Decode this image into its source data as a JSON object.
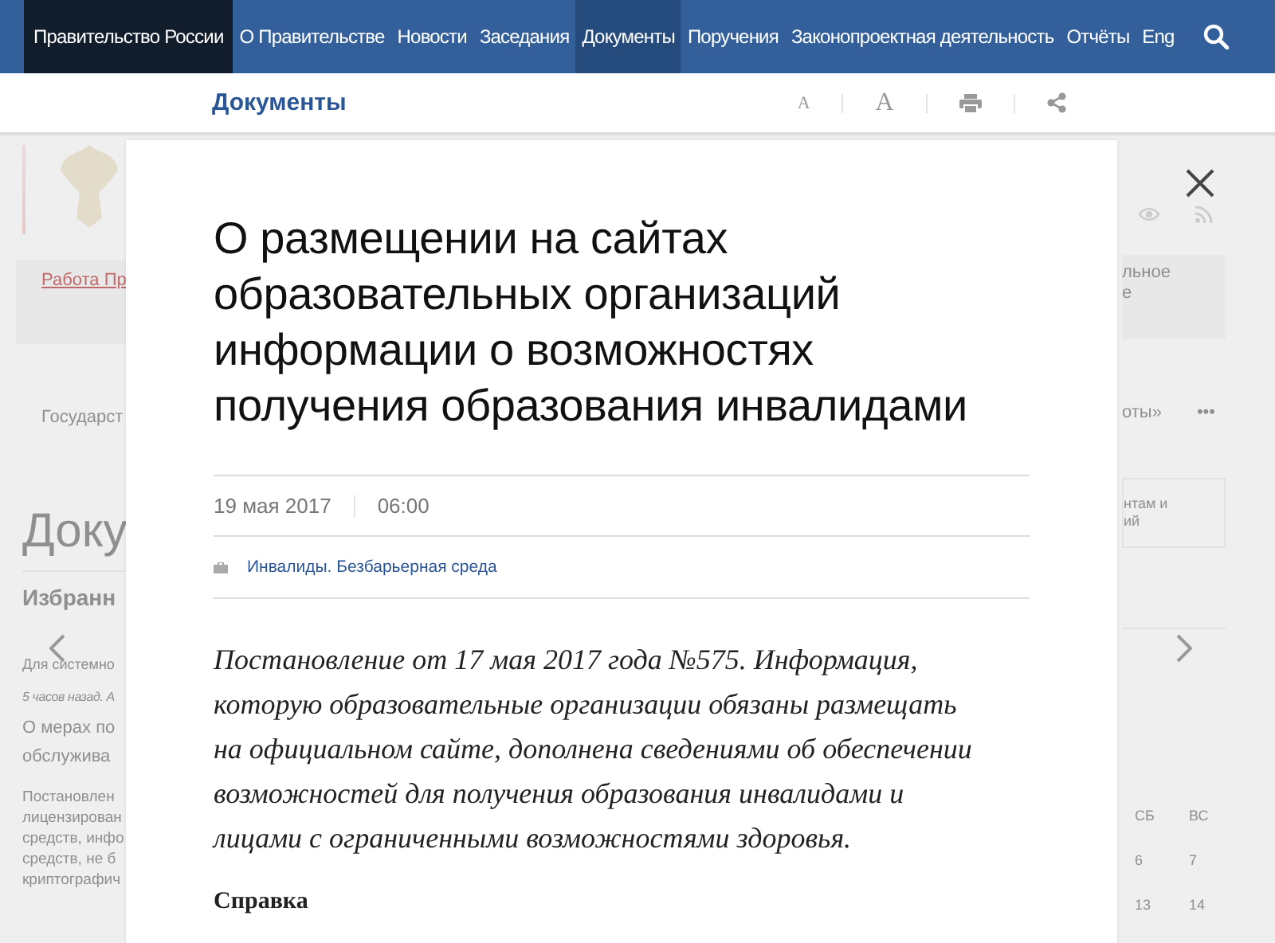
{
  "nav": {
    "brand": "Правительство России",
    "items": [
      {
        "label": "О Правительстве",
        "selected": false
      },
      {
        "label": "Новости",
        "selected": false
      },
      {
        "label": "Заседания",
        "selected": false
      },
      {
        "label": "Документы",
        "selected": true
      },
      {
        "label": "Поручения",
        "selected": false
      },
      {
        "label": "Законопроектная деятельность",
        "selected": false
      },
      {
        "label": "Отчёты",
        "selected": false
      },
      {
        "label": "Eng",
        "selected": false
      }
    ]
  },
  "subheader": {
    "title": "Документы",
    "small_font_label": "A",
    "large_font_label": "A"
  },
  "background": {
    "left": {
      "card_link": "Работа Пр",
      "menu_item": "Государст",
      "heading": "Доку",
      "subheading": "Избранн",
      "caption": "Для системно",
      "meta": "5 часов назад. А",
      "news_title": [
        "О мерах по",
        "обслужива"
      ],
      "summary": [
        "Постановлен",
        "лицензирован",
        "средств, инфо",
        "средств, не б",
        "криптографич"
      ]
    },
    "right": {
      "card_text": [
        "льное",
        "е"
      ],
      "menu_item": "оты»",
      "more": "•••",
      "box_text": [
        "нтам и",
        "ий"
      ],
      "calendar": {
        "days": [
          "СБ",
          "ВС"
        ],
        "rows": [
          [
            "6",
            "7"
          ],
          [
            "13",
            "14"
          ]
        ]
      }
    }
  },
  "modal": {
    "title": "О размещении на сайтах образовательных организаций информации о возможностях получения образования инвалидами",
    "date": "19 мая 2017",
    "time": "06:00",
    "tag": "Инвалиды. Безбарьерная среда",
    "lead": "Постановление от 17 мая 2017 года №575. Информация, которую образовательные организации обязаны размещать на официальном сайте, дополнена сведениями об обеспечении возможностей для получения образования инвалидами и лицами с ограниченными возможностями здоровья.",
    "section_heading": "Справка"
  }
}
